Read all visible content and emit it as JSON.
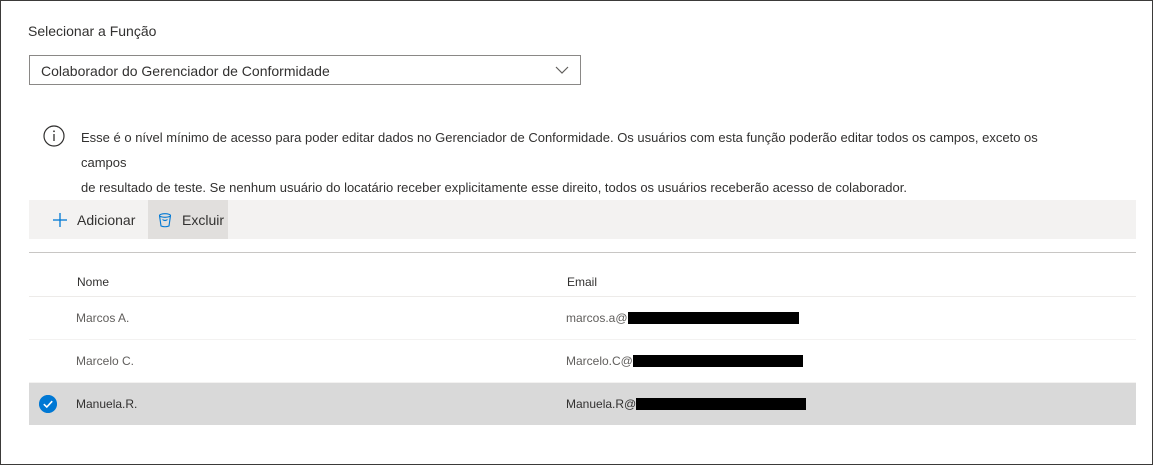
{
  "role_label": "Selecionar a Função",
  "role_dropdown": {
    "value": "Colaborador do Gerenciador de Conformidade",
    "icon": "chevron-down-icon"
  },
  "info": {
    "icon": "info-icon",
    "line1": "Esse é o nível mínimo de acesso para poder editar dados no Gerenciador de Conformidade. Os usuários com esta função poderão editar todos os campos, exceto os campos",
    "line2": "de resultado de teste. Se nenhum usuário do locatário receber explicitamente esse direito, todos os usuários receberão acesso de colaborador."
  },
  "commands": {
    "add_label": "Adicionar",
    "add_icon": "plus-icon",
    "delete_label": "Excluir",
    "delete_icon": "trash-icon"
  },
  "table": {
    "headers": {
      "name": "Nome",
      "email": "Email"
    },
    "rows": [
      {
        "name": "Marcos A.",
        "email_prefix": "marcos.a@",
        "selected": false
      },
      {
        "name": "Marcelo C.",
        "email_prefix": "Marcelo.C@",
        "selected": false
      },
      {
        "name": "Manuela.R.",
        "email_prefix": "Manuela.R@",
        "selected": true
      }
    ]
  },
  "colors": {
    "accent": "#0078d4",
    "selected_row": "#d9d9d9",
    "command_bar": "#f3f2f1"
  }
}
